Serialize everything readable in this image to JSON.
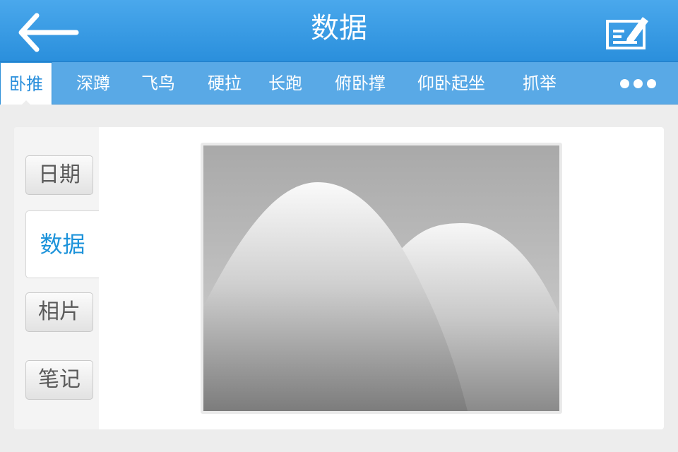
{
  "header": {
    "title": "数据",
    "back_icon": "arrow-left-icon",
    "edit_icon": "edit-note-icon"
  },
  "tabs": [
    {
      "label": "卧推",
      "active": true
    },
    {
      "label": "深蹲",
      "active": false
    },
    {
      "label": "飞鸟",
      "active": false
    },
    {
      "label": "硬拉",
      "active": false
    },
    {
      "label": "长跑",
      "active": false
    },
    {
      "label": "俯卧撑",
      "active": false
    },
    {
      "label": "仰卧起坐",
      "active": false
    },
    {
      "label": "抓举",
      "active": false
    }
  ],
  "more_icon": "more-dots-icon",
  "sidebar": {
    "items": [
      {
        "label": "日期"
      },
      {
        "label": "数据",
        "active": true
      },
      {
        "label": "相片"
      },
      {
        "label": "笔记"
      }
    ]
  },
  "main": {
    "image_icon": "image-placeholder-icon"
  },
  "colors": {
    "header_bg": "#2a8fdc",
    "tabbar_bg": "#59a9e6",
    "accent": "#1d93da",
    "page_bg": "#ededed"
  }
}
